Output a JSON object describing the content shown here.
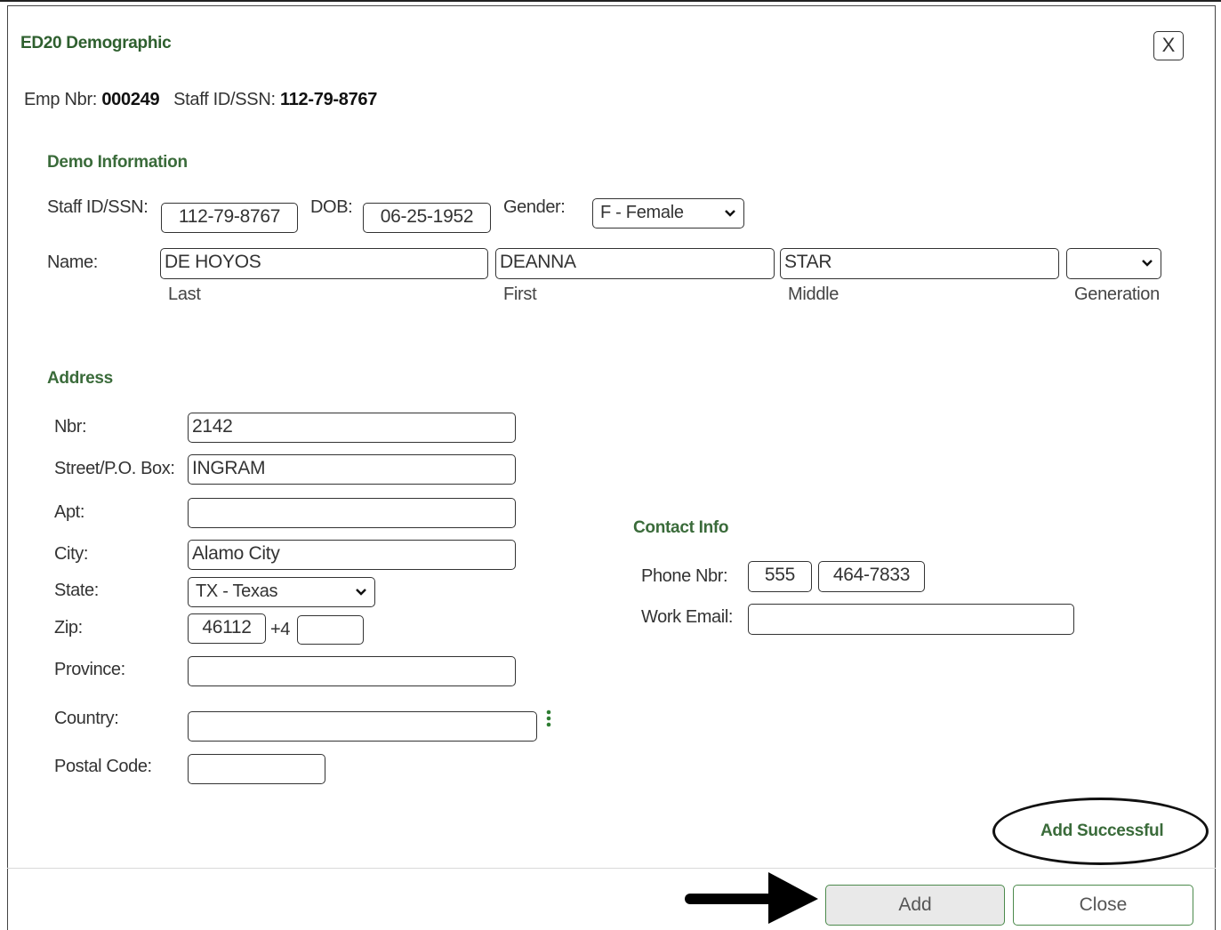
{
  "dialog": {
    "title": "ED20 Demographic",
    "close_icon_label": "X"
  },
  "header": {
    "emp_nbr_label": "Emp Nbr:",
    "emp_nbr_value": "000249",
    "staff_id_label": "Staff ID/SSN:",
    "staff_id_value": "112-79-8767"
  },
  "demo": {
    "section_title": "Demo Information",
    "staff_id_label": "Staff ID/SSN:",
    "staff_id_value": "112-79-8767",
    "dob_label": "DOB:",
    "dob_value": "06-25-1952",
    "gender_label": "Gender:",
    "gender_value": "F - Female",
    "name_label": "Name:",
    "last_value": "DE HOYOS",
    "first_value": "DEANNA",
    "middle_value": "STAR",
    "generation_value": "",
    "last_caption": "Last",
    "first_caption": "First",
    "middle_caption": "Middle",
    "generation_caption": "Generation"
  },
  "address": {
    "section_title": "Address",
    "nbr_label": "Nbr:",
    "nbr_value": "2142",
    "street_label": "Street/P.O. Box:",
    "street_value": "INGRAM",
    "apt_label": "Apt:",
    "apt_value": "",
    "city_label": "City:",
    "city_value": "Alamo City",
    "state_label": "State:",
    "state_value": "TX - Texas",
    "zip_label": "Zip:",
    "zip_value": "46112",
    "zip4_label": "+4",
    "zip4_value": "",
    "province_label": "Province:",
    "province_value": "",
    "country_label": "Country:",
    "country_value": "",
    "postal_label": "Postal Code:",
    "postal_value": ""
  },
  "contact": {
    "section_title": "Contact Info",
    "phone_label": "Phone Nbr:",
    "phone_area": "555",
    "phone_number": "464-7833",
    "email_label": "Work Email:",
    "email_value": ""
  },
  "status": {
    "message": "Add Successful"
  },
  "buttons": {
    "add": "Add",
    "close": "Close"
  },
  "icons": {
    "close": "close-icon",
    "dropdown": "chevron-down-icon",
    "more": "more-vertical-icon",
    "arrow": "arrow-right-icon"
  }
}
